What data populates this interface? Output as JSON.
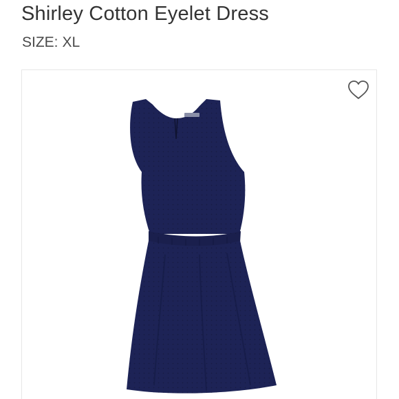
{
  "product": {
    "title": "Shirley Cotton Eyelet Dress",
    "size_label": "SIZE:",
    "size_value": "XL"
  },
  "image": {
    "alt": "Navy sleeveless cotton eyelet dress"
  },
  "icons": {
    "favorite": "heart-outline-icon"
  },
  "colors": {
    "dress": "#1d2356",
    "title_text": "#333333",
    "heart_stroke": "#555555"
  }
}
